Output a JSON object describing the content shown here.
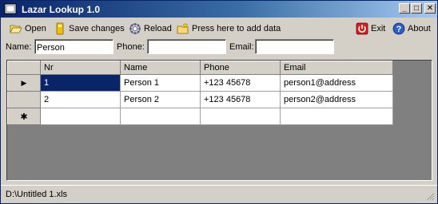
{
  "window": {
    "title": "Lazar Lookup 1.0"
  },
  "title_buttons": {
    "minimize": "_",
    "maximize": "□",
    "close": "✕"
  },
  "toolbar": {
    "open": "Open",
    "save": "Save changes",
    "reload": "Reload",
    "add": "Press here to add data",
    "exit": "Exit",
    "about": "About"
  },
  "filters": {
    "name_label": "Name:",
    "name_value": "Person",
    "phone_label": "Phone:",
    "phone_value": "",
    "email_label": "Email:",
    "email_value": ""
  },
  "grid": {
    "columns": [
      "Nr",
      "Name",
      "Phone",
      "Email"
    ],
    "rows": [
      {
        "marker": "▶",
        "nr": "1",
        "name": "Person 1",
        "phone": "+123 45678",
        "email": "person1@address"
      },
      {
        "marker": "",
        "nr": "2",
        "name": "Person 2",
        "phone": "+123 45678",
        "email": "person2@address"
      }
    ],
    "new_row_marker": "✱"
  },
  "statusbar": {
    "path": "D:\\Untitled 1.xls"
  },
  "colors": {
    "title_start": "#0a246a",
    "title_end": "#a6caf0",
    "selection": "#0a246a",
    "face": "#d4d0c8"
  },
  "icons": [
    "app-icon",
    "folder-open-icon",
    "save-icon",
    "reload-icon",
    "add-folder-icon",
    "power-icon",
    "help-icon",
    "resize-grip-icon"
  ]
}
